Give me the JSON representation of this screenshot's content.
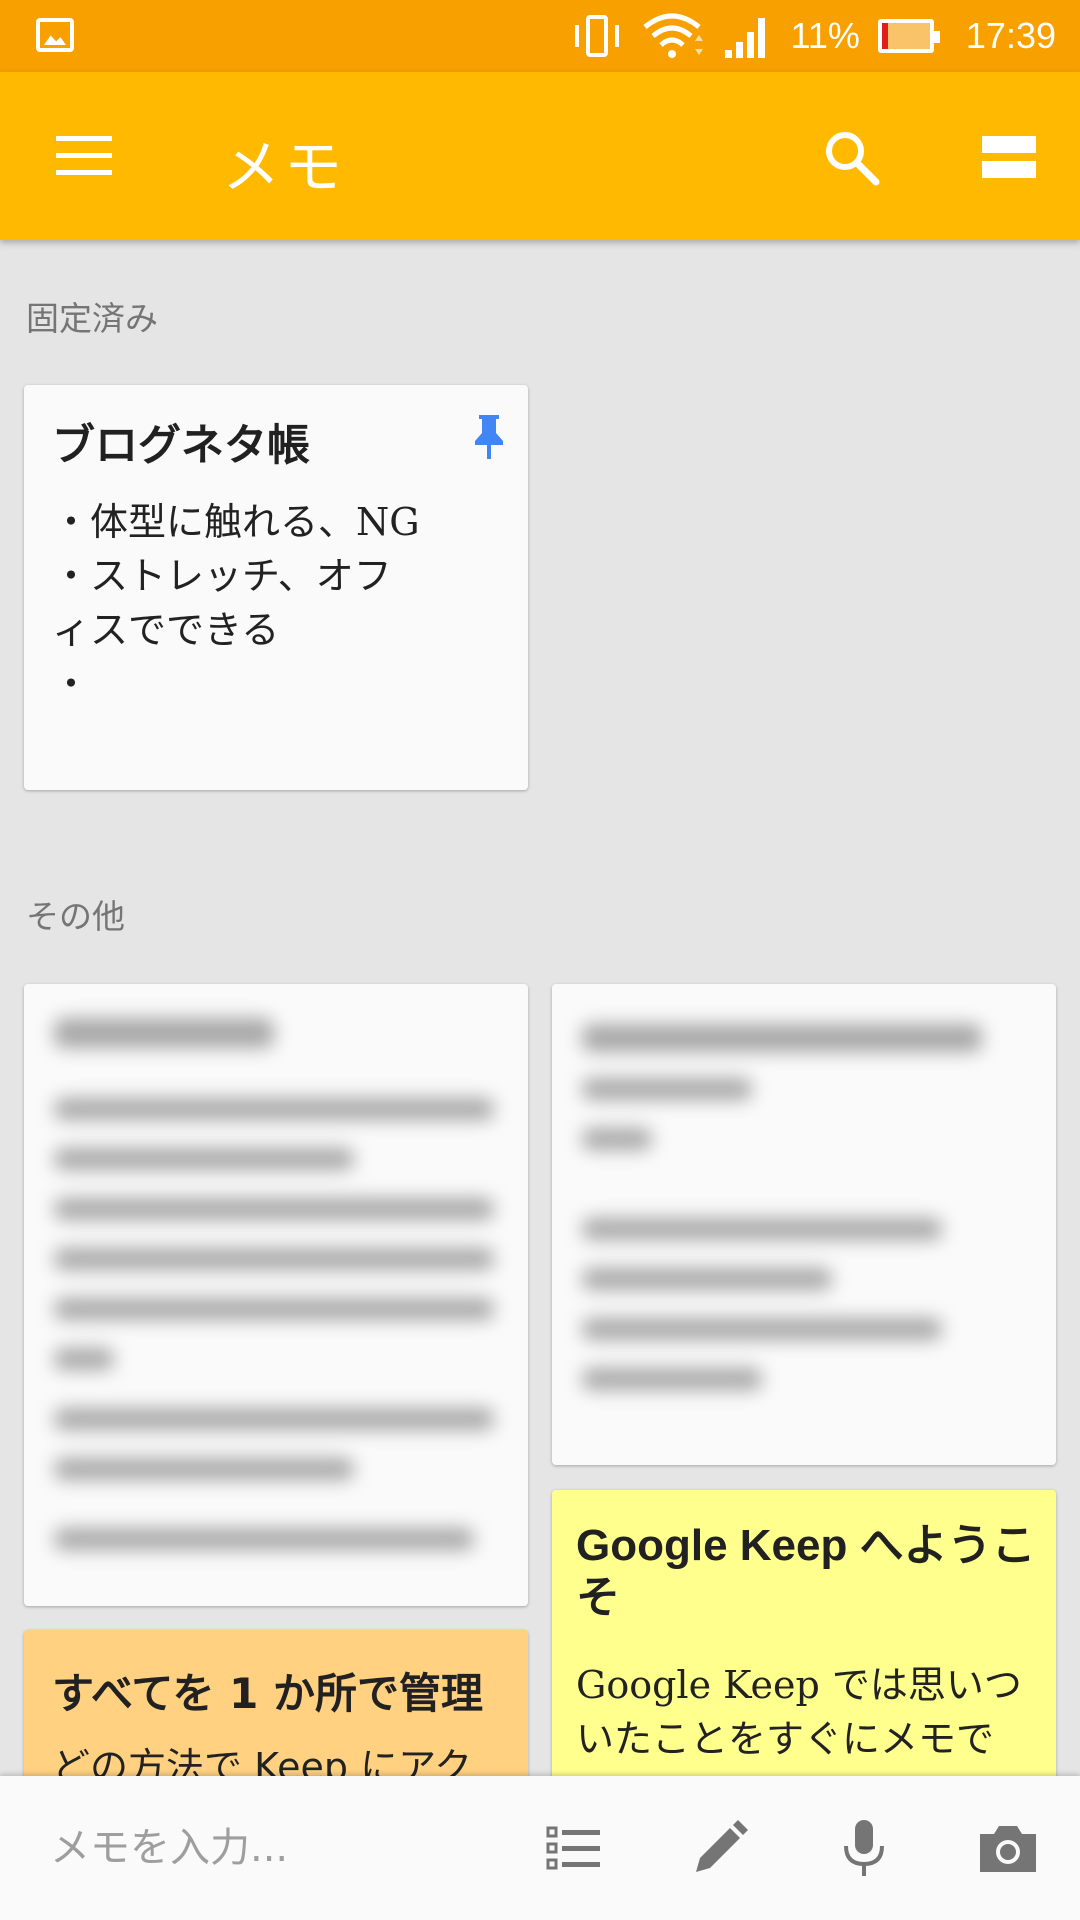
{
  "status_bar": {
    "battery_percent": "11%",
    "time": "17:39",
    "icons": [
      "gallery-icon",
      "vibrate-icon",
      "wifi-icon",
      "signal-icon",
      "battery-icon"
    ]
  },
  "app_bar": {
    "title": "メモ",
    "icons": [
      "menu-icon",
      "search-icon",
      "view-toggle-icon"
    ],
    "color": "#ffba00"
  },
  "sections": {
    "pinned_label": "固定済み",
    "others_label": "その他"
  },
  "pinned_note": {
    "title": "ブログネタ帳",
    "body": "・体型に触れる、NG\n・ストレッチ、オフ\nィスでできる\n・",
    "icon": "pin-icon"
  },
  "other_notes": [
    {
      "id": "note-blurred-1",
      "blurred": true
    },
    {
      "id": "note-blurred-2",
      "blurred": true
    },
    {
      "title": "すべてを 1 か所で管理",
      "body": "どの方法で Keep にアク",
      "color": "#ffd180"
    },
    {
      "title": "Google Keep へようこそ",
      "body": "Google Keep では思いついたことをすぐにメモで",
      "color": "#ffff8d"
    }
  ],
  "bottom_bar": {
    "input_placeholder": "メモを入力...",
    "icons": [
      "list-icon",
      "pen-icon",
      "mic-icon",
      "camera-icon"
    ]
  }
}
